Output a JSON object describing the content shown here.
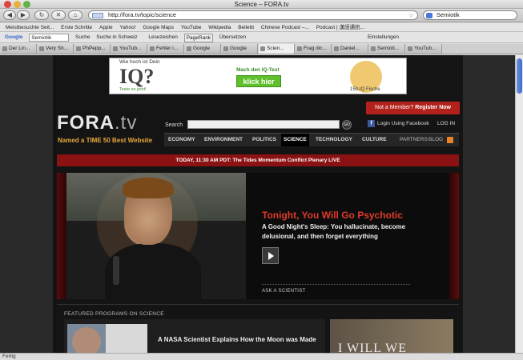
{
  "window": {
    "title": "Science – FORA.tv",
    "url": "http://fora.tv/topic/science",
    "search_value": "Semiotik",
    "status": "Fertig"
  },
  "nav_buttons": {
    "back": "◀",
    "forward": "▶",
    "stop": "✕",
    "home": "⌂"
  },
  "bookmarks": [
    "Meistbesuchte Seit...",
    "Erste Schritte",
    "Apple",
    "Yahoo!",
    "Google Maps",
    "YouTube",
    "Wikipedia",
    "Beliebt",
    "Chinese Podcast –...",
    "Podcast | 漢語通訊..."
  ],
  "googlebar": {
    "brand": "Google",
    "query": "Semiotik",
    "items": [
      "Suche",
      "Suche in Schweiz",
      "Lesezeichen",
      "PageRank",
      "Übersetzen",
      "Einstellungen"
    ]
  },
  "tabs": [
    "Der Lin...",
    "Very Sh...",
    "PhPepp...",
    "YouTub...",
    "Fehler i...",
    "Google",
    "Google",
    "Scien...",
    "Frag dic...",
    "Daniel...",
    "Semioti...",
    "YouTub..."
  ],
  "ad": {
    "line1": "Wie hoch ist Dein",
    "big": "IQ?",
    "link": "Teste es jetzt!",
    "cta_text": "Mach den IQ-Test",
    "cta_button": "klick hier",
    "brand": "150-IQ Fische"
  },
  "site": {
    "logo_main": "FORA",
    "logo_tld": ".tv",
    "tagline": "Named a TIME 50 Best Website",
    "search_label": "Search",
    "search_go": "GO",
    "member_prefix": "Not a Member?",
    "member_action": "Register Now",
    "facebook_login": "Login Using Facebook",
    "login": "LOG IN",
    "nav": [
      "ECONOMY",
      "ENVIRONMENT",
      "POLITICS",
      "SCIENCE",
      "TECHNOLOGY",
      "CULTURE"
    ],
    "nav_secondary": [
      "PARTNERS",
      "BLOG"
    ],
    "active_nav": "SCIENCE",
    "alert": "TODAY, 11:30 AM PDT: The Tides Momentum Conflict Plenary LIVE"
  },
  "hero": {
    "title": "Tonight, You Will Go Psychotic",
    "description": "A Good Night's Sleep: You hallucinate, become delusional, and then forget everything",
    "category": "ASK A SCIENTIST"
  },
  "featured": {
    "heading": "FEATURED PROGRAMS ON SCIENCE",
    "card1_title": "A NASA Scientist Explains How the Moon was Made",
    "card2_text": "I WILL WE"
  }
}
